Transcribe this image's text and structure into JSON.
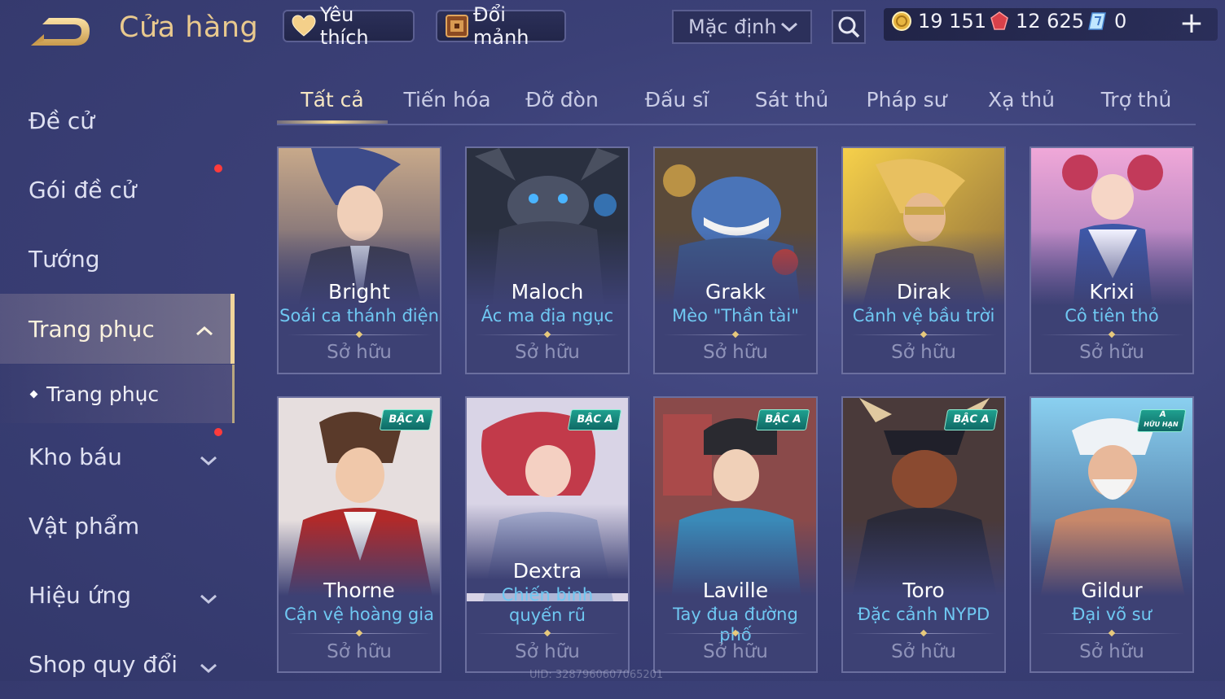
{
  "header": {
    "title": "Cửa hàng",
    "favorite_label": "Yêu thích",
    "exchange_label": "Đổi mảnh",
    "sort_value": "Mặc định"
  },
  "currencies": [
    {
      "icon": "gold-coin-icon",
      "value": "19 151"
    },
    {
      "icon": "red-voucher-icon",
      "value": "12 625"
    },
    {
      "icon": "blue-crystal-icon",
      "value": "0"
    }
  ],
  "sidebar": {
    "items": [
      {
        "label": "Đề cử"
      },
      {
        "label": "Gói đề cử"
      },
      {
        "label": "Tướng"
      },
      {
        "label": "Trang phục"
      },
      {
        "label": "Kho báu"
      },
      {
        "label": "Vật phẩm"
      },
      {
        "label": "Hiệu ứng"
      },
      {
        "label": "Shop quy đổi"
      }
    ],
    "sub_item": "Trang phục"
  },
  "tabs": [
    "Tất cả",
    "Tiến hóa",
    "Đỡ đòn",
    "Đấu sĩ",
    "Sát thủ",
    "Pháp sư",
    "Xạ thủ",
    "Trợ thủ"
  ],
  "cards": [
    {
      "hero": "Bright",
      "skin": "Soái ca thánh điện",
      "status": "Sở hữu"
    },
    {
      "hero": "Maloch",
      "skin": "Ác ma địa ngục",
      "status": "Sở hữu"
    },
    {
      "hero": "Grakk",
      "skin": "Mèo \"Thần tài\"",
      "status": "Sở hữu"
    },
    {
      "hero": "Dirak",
      "skin": "Cảnh vệ bầu trời",
      "status": "Sở hữu"
    },
    {
      "hero": "Krixi",
      "skin": "Cô tiên thỏ",
      "status": "Sở hữu"
    },
    {
      "hero": "Thorne",
      "skin": "Cận vệ hoàng gia",
      "status": "Sở hữu",
      "badge": "BẬC A"
    },
    {
      "hero": "Dextra",
      "skin": "Chiến binh quyến rũ",
      "status": "Sở hữu",
      "badge": "BẬC A"
    },
    {
      "hero": "Laville",
      "skin": "Tay đua đường phố",
      "status": "Sở hữu",
      "badge": "BẬC A"
    },
    {
      "hero": "Toro",
      "skin": "Đặc cảnh NYPD",
      "status": "Sở hữu",
      "badge": "BẬC A"
    },
    {
      "hero": "Gildur",
      "skin": "Đại võ sư",
      "status": "Sở hữu",
      "badge_top": "A",
      "badge_bottom": "HỮU HẠN"
    }
  ],
  "footer": {
    "uid": "UID: 3287960607065201"
  }
}
